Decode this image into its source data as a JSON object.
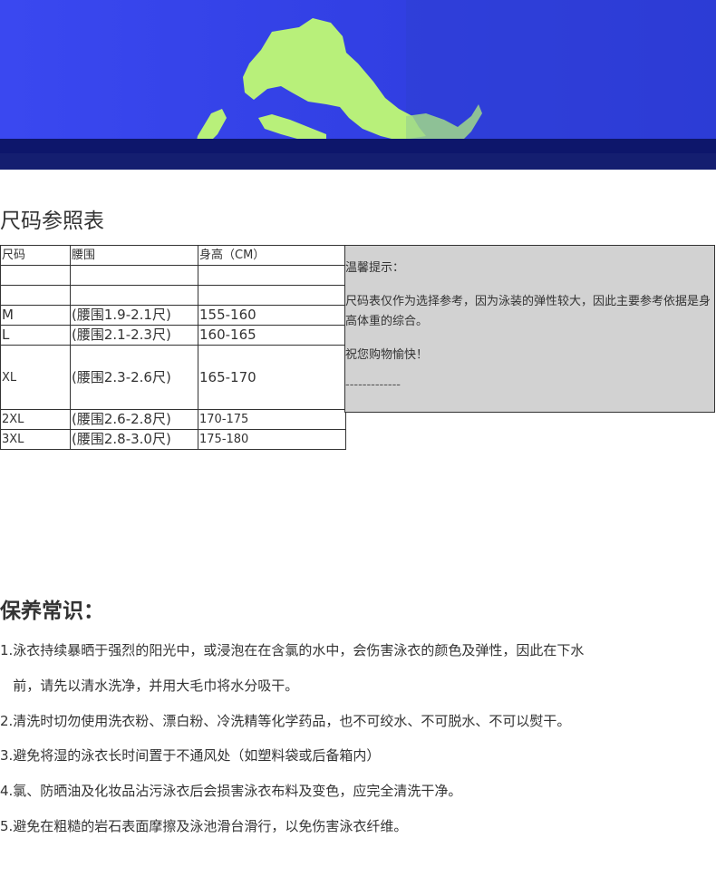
{
  "size_chart": {
    "title": "尺码参照表",
    "headers": [
      "尺码",
      "腰围",
      "身高（CM）"
    ],
    "rows": [
      [
        "",
        "",
        ""
      ],
      [
        "",
        "",
        ""
      ],
      [
        "M",
        "(腰围1.9-2.1尺)",
        "155-160"
      ],
      [
        "L",
        "(腰围2.1-2.3尺)",
        "160-165"
      ],
      [
        "XL",
        "(腰围2.3-2.6尺)",
        "165-170"
      ],
      [
        "2XL",
        "(腰围2.6-2.8尺)",
        "170-175"
      ],
      [
        "3XL",
        "(腰围2.8-3.0尺)",
        "175-180"
      ]
    ]
  },
  "note": {
    "heading": "温馨提示：",
    "body": "尺码表仅作为选择参考，因为泳装的弹性较大，因此主要参考依据是身高体重的综合。",
    "wish": "祝您购物愉快！",
    "dashes": "-------------"
  },
  "care": {
    "title": "保养常识：",
    "lines": [
      "1.泳衣持续暴晒于强烈的阳光中，或浸泡在在含氯的水中，会伤害泳衣的颜色及弹性，因此在下水",
      "   前，请先以清水洗净，并用大毛巾将水分吸干。",
      "2.清洗时切勿使用洗衣粉、漂白粉、冷洗精等化学药品，也不可绞水、不可脱水、不可以熨干。",
      "3.避免将湿的泳衣长时间置于不通风处（如塑料袋或后备箱内）",
      "4.氯、防晒油及化妆品沾污泳衣后会损害泳衣布料及变色，应完全清洗干净。",
      "5.避免在粗糙的岩石表面摩擦及泳池滑台滑行，以免伤害泳衣纤维。"
    ]
  },
  "colors": {
    "banner_blue": "#2e3de0",
    "banner_dark": "#0e1870",
    "land_green": "#b8f07a",
    "note_bg": "#d2d2d2"
  }
}
